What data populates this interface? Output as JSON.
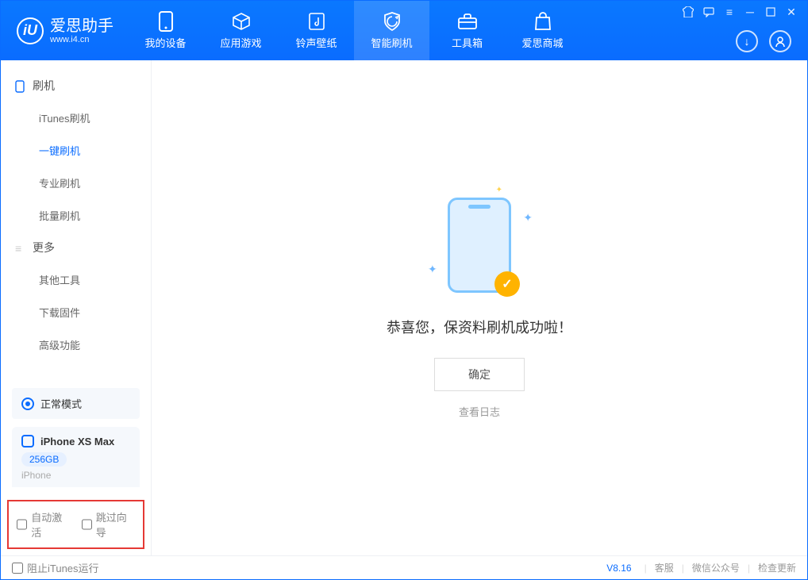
{
  "app": {
    "name": "爱思助手",
    "url": "www.i4.cn"
  },
  "tabs": [
    {
      "label": "我的设备"
    },
    {
      "label": "应用游戏"
    },
    {
      "label": "铃声壁纸"
    },
    {
      "label": "智能刷机",
      "active": true
    },
    {
      "label": "工具箱"
    },
    {
      "label": "爱思商城"
    }
  ],
  "sidebar": {
    "group1": {
      "title": "刷机",
      "items": [
        "iTunes刷机",
        "一键刷机",
        "专业刷机",
        "批量刷机"
      ],
      "activeIndex": 1
    },
    "group2": {
      "title": "更多",
      "items": [
        "其他工具",
        "下载固件",
        "高级功能"
      ]
    },
    "mode": "正常模式",
    "device": {
      "name": "iPhone XS Max",
      "capacity": "256GB",
      "type": "iPhone"
    },
    "options": {
      "autoActivate": "自动激活",
      "skipWizard": "跳过向导"
    }
  },
  "content": {
    "success": "恭喜您，保资料刷机成功啦！",
    "ok": "确定",
    "viewLog": "查看日志"
  },
  "footer": {
    "blockITunes": "阻止iTunes运行",
    "version": "V8.16",
    "links": [
      "客服",
      "微信公众号",
      "检查更新"
    ]
  }
}
